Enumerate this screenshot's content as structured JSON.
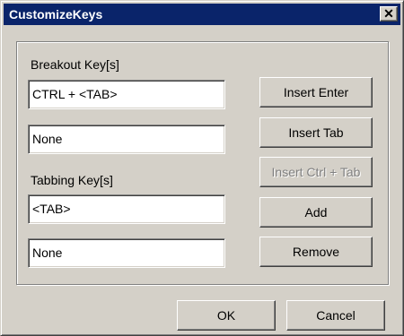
{
  "window": {
    "title": "CustomizeKeys",
    "close_icon": "close-icon",
    "close_glyph": "✕",
    "titlebar_color": "#0a246a",
    "face_color": "#d4d0c8"
  },
  "breakout": {
    "label": "Breakout Key[s]",
    "value1": "CTRL + <TAB>",
    "value2": "None"
  },
  "tabbing": {
    "label": "Tabbing Key[s]",
    "value1": "<TAB>",
    "value2": "None"
  },
  "buttons": {
    "insert_enter": "Insert Enter",
    "insert_tab": "Insert Tab",
    "insert_ctrl_tab": "Insert Ctrl + Tab",
    "add": "Add",
    "remove": "Remove",
    "ok": "OK",
    "cancel": "Cancel"
  }
}
